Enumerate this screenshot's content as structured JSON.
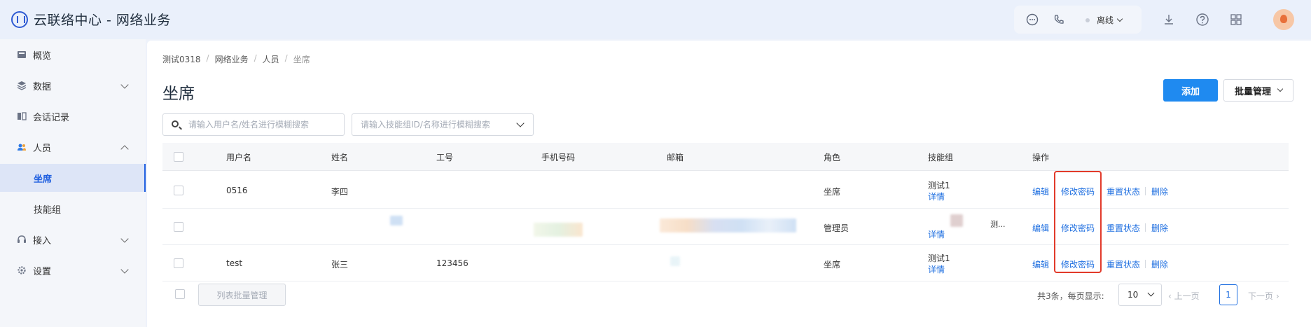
{
  "app": {
    "title": "云联络中心 - 网络业务"
  },
  "header": {
    "status": "离线"
  },
  "sidebar": {
    "items": [
      {
        "label": "概览"
      },
      {
        "label": "数据"
      },
      {
        "label": "会话记录"
      },
      {
        "label": "人员"
      },
      {
        "label": "坐席"
      },
      {
        "label": "技能组"
      },
      {
        "label": "接入"
      },
      {
        "label": "设置"
      }
    ]
  },
  "breadcrumb": [
    "测试0318",
    "网络业务",
    "人员",
    "坐席"
  ],
  "page": {
    "title": "坐席"
  },
  "toolbar": {
    "add_label": "添加",
    "batch_label": "批量管理"
  },
  "search": {
    "user_placeholder": "请输入用户名/姓名进行模糊搜索",
    "group_placeholder": "请输入技能组ID/名称进行模糊搜索"
  },
  "table": {
    "headers": [
      "用户名",
      "姓名",
      "工号",
      "手机号码",
      "邮箱",
      "角色",
      "技能组",
      "操作"
    ],
    "rows": [
      {
        "username": "0516",
        "name": "李四",
        "job_no": "",
        "phone": "",
        "email": "",
        "role": "坐席",
        "group": "测试1",
        "detail": "详情"
      },
      {
        "username": "",
        "name": "",
        "job_no": "",
        "phone": "",
        "email": "",
        "role": "管理员",
        "group": "",
        "detail": "详情",
        "group_extra": "测..."
      },
      {
        "username": "test",
        "name": "张三",
        "job_no": "123456",
        "phone": "",
        "email": "",
        "role": "坐席",
        "group": "测试1",
        "detail": "详情"
      }
    ],
    "actions": {
      "edit": "编辑",
      "change_pwd": "修改密码",
      "reset_status": "重置状态",
      "delete": "删除"
    }
  },
  "footer": {
    "col_batch": "列表批量管理",
    "total": "共3条，每页显示:",
    "page_size": "10",
    "prev": "上一页",
    "page": "1",
    "next": "下一页"
  }
}
